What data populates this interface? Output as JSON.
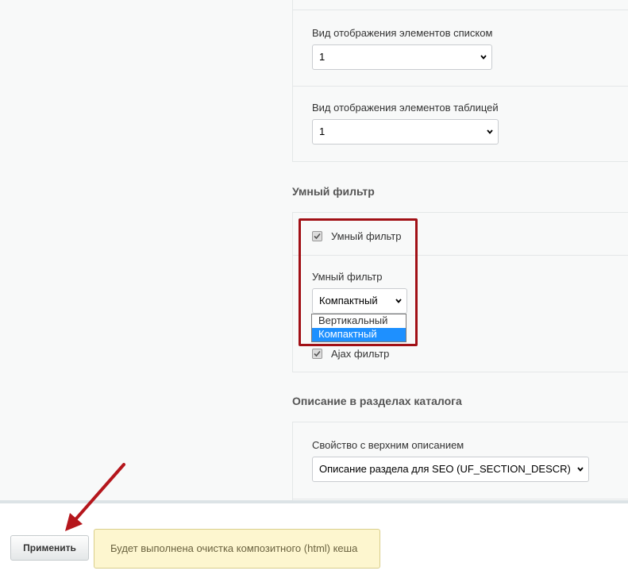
{
  "list_view": {
    "label": "Вид отображения элементов списком",
    "value": "1"
  },
  "table_view": {
    "label": "Вид отображения элементов таблицей",
    "value": "1"
  },
  "smart_filter_section": {
    "title": "Умный фильтр",
    "checkbox_label": "Умный фильтр",
    "checkbox_checked": true,
    "select_label": "Умный фильтр",
    "select_value": "Компактный",
    "options": [
      "Вертикальный",
      "Компактный"
    ],
    "ajax_label": "Ajax фильтр",
    "ajax_checked": true
  },
  "description_section": {
    "title": "Описание в разделах каталога",
    "property_label": "Свойство с верхним описанием",
    "property_value": "Описание раздела для SEO (UF_SECTION_DESCR)"
  },
  "footer": {
    "apply_label": "Применить",
    "notice": "Будет выполнена очистка композитного (html) кеша"
  },
  "colors": {
    "highlight": "#a11016",
    "arrow": "#b5161c",
    "notice_bg": "#fdf6cf",
    "option_selected": "#1e90ff"
  }
}
